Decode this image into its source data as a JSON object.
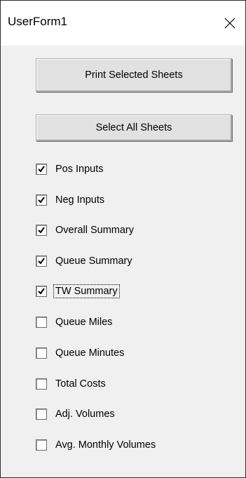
{
  "window": {
    "title": "UserForm1",
    "close_icon": "close-icon"
  },
  "buttons": {
    "print_label": "Print Selected Sheets",
    "select_all_label": "Select All Sheets"
  },
  "checkboxes": [
    {
      "label": "Pos Inputs",
      "checked": true
    },
    {
      "label": "Neg Inputs",
      "checked": true
    },
    {
      "label": "Overall Summary",
      "checked": true
    },
    {
      "label": "Queue Summary",
      "checked": true
    },
    {
      "label": "TW Summary",
      "checked": true,
      "focused": true
    },
    {
      "label": "Queue Miles",
      "checked": false
    },
    {
      "label": "Queue Minutes",
      "checked": false
    },
    {
      "label": "Total Costs",
      "checked": false
    },
    {
      "label": "Adj. Volumes",
      "checked": false
    },
    {
      "label": "Avg. Monthly Volumes",
      "checked": false
    }
  ]
}
